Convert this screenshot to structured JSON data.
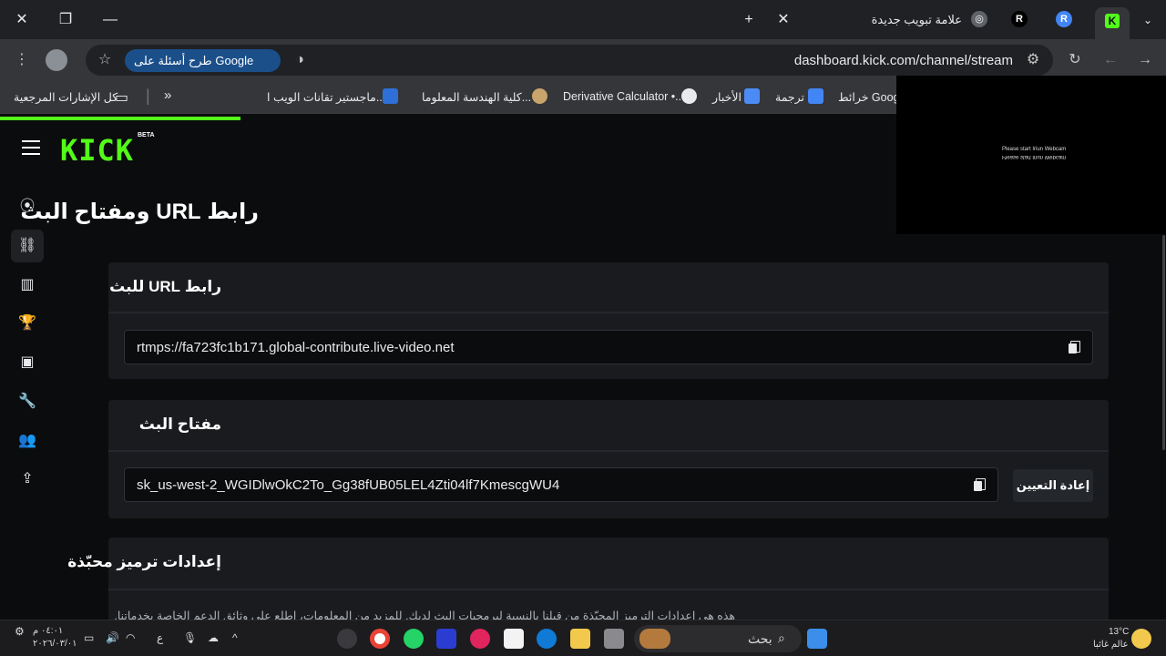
{
  "browser": {
    "tab_new_title": "علامة تبويب جديدة",
    "address": "dashboard.kick.com/channel/stream",
    "google_pill": "طرح أسئلة على Google",
    "bookmarks": [
      "كل الإشارات المرجعية",
      "ماجستير تقانات الويب ا...",
      "كلية الهندسة المعلوما...",
      "Derivative Calculator •...",
      "الأخبار",
      "ترجمة",
      "خرائط Google"
    ]
  },
  "page": {
    "logo": "KICK",
    "beta": "BETA",
    "title": "رابط URL ومفتاح البث",
    "url_card": {
      "heading": "رابط URL للبث",
      "value": "rtmps://fa723fc1b171.global-contribute.live-video.net"
    },
    "key_card": {
      "heading": "مفتاح البث",
      "value": "sk_us-west-2_WGIDlwOkC2To_Gg38fUB05LEL4Zti04lf7KmescgWU4",
      "reset_label": "إعادة التعيين"
    },
    "encoder_card": {
      "heading": "إعدادات ترميز محبّذة",
      "description": "هذه هي إعدادات الترميز المحبّذة من قبلنا بالنسبة لبرمجيات البث لديك. للمزيد من المعلومات، اطلع على وثائق الدعم الخاصة بخدماتنا."
    },
    "overlay": {
      "line1": "Please start Iriun Webcam",
      "line2": "Please start Iriun Webcam"
    }
  },
  "taskbar": {
    "search_label": "بحث",
    "weather_temp": "13°C",
    "weather_desc": "عالم غائبا",
    "time": "٠٤:٠١ م",
    "date": "٢٠٢٦/٠٣/٠١",
    "lang": "ع"
  },
  "colors": {
    "accent": "#53fc18",
    "bg": "#0b0c0d",
    "card": "#191b1f"
  }
}
